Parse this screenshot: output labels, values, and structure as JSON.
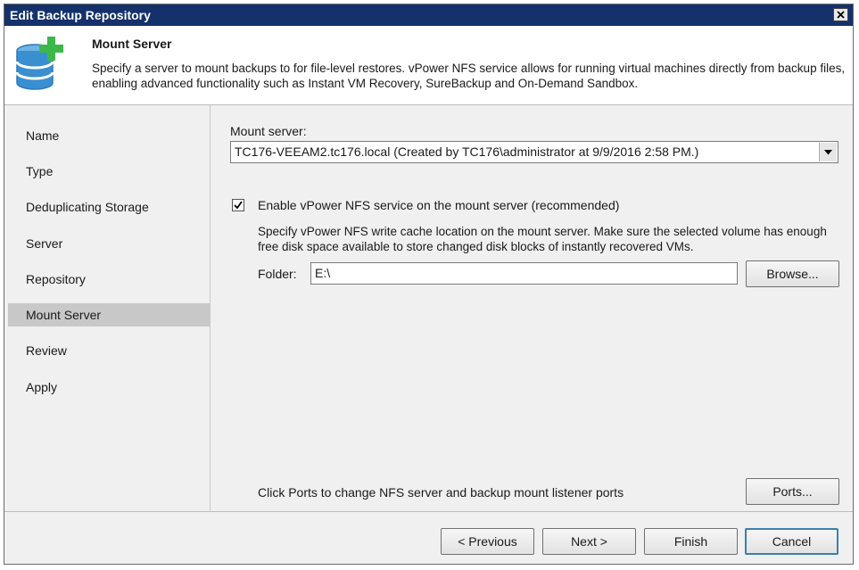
{
  "window": {
    "title": "Edit Backup Repository"
  },
  "header": {
    "title": "Mount Server",
    "description": "Specify a server to mount backups to for file-level restores. vPower NFS service allows for running virtual machines directly from backup files, enabling advanced functionality such as Instant VM Recovery, SureBackup and On-Demand Sandbox."
  },
  "sidebar": {
    "items": [
      {
        "label": "Name"
      },
      {
        "label": "Type"
      },
      {
        "label": "Deduplicating Storage"
      },
      {
        "label": "Server"
      },
      {
        "label": "Repository"
      },
      {
        "label": "Mount Server",
        "active": true
      },
      {
        "label": "Review"
      },
      {
        "label": "Apply"
      }
    ]
  },
  "main": {
    "mount_server_label": "Mount server:",
    "mount_server_value": "TC176-VEEAM2.tc176.local (Created by TC176\\administrator at 9/9/2016 2:58 PM.)",
    "enable_nfs_label": "Enable vPower NFS service on the mount server (recommended)",
    "enable_nfs_checked": true,
    "nfs_hint": "Specify vPower NFS write cache location on the mount server. Make sure the selected volume has enough free disk space available to store changed disk blocks of instantly recovered VMs.",
    "folder_label": "Folder:",
    "folder_value": "E:\\",
    "browse_label": "Browse...",
    "ports_hint": "Click Ports to change NFS server and backup mount listener ports",
    "ports_label": "Ports..."
  },
  "footer": {
    "previous_label": "< Previous",
    "next_label": "Next >",
    "finish_label": "Finish",
    "cancel_label": "Cancel"
  },
  "colors": {
    "titlebar": "#14316b",
    "active_nav": "#c8c8c8",
    "db_icon": "#3a8fd0",
    "plus_icon": "#3cb84a"
  }
}
